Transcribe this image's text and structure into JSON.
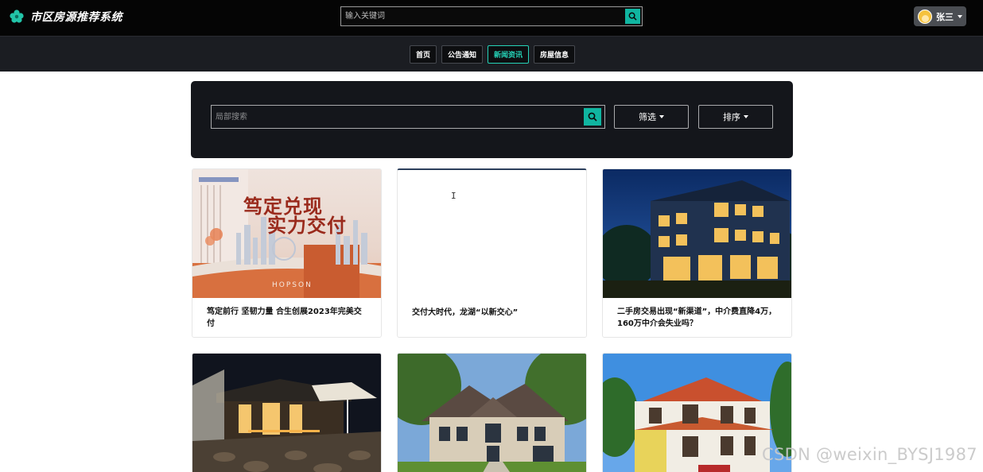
{
  "app": {
    "title": "市区房源推荐系统"
  },
  "header": {
    "search_placeholder": "输入关键词",
    "user_name": "张三"
  },
  "nav": {
    "items": [
      {
        "label": "首页",
        "active": false
      },
      {
        "label": "公告通知",
        "active": false
      },
      {
        "label": "新闻资讯",
        "active": true
      },
      {
        "label": "房屋信息",
        "active": false
      }
    ]
  },
  "filter_panel": {
    "search_placeholder": "局部搜索",
    "filter_label": "筛选",
    "sort_label": "排序"
  },
  "news_cards": [
    {
      "title": "笃定前行 坚韧力量 合生创展2023年完美交付",
      "image_text": [
        "笃定兑现",
        "实力交付"
      ],
      "image_brand": "HOPSON"
    },
    {
      "title": "交付大时代，龙湖“以新交心”"
    },
    {
      "title": "二手房交易出现“新渠道”，中介费直降4万，160万中介会失业吗？"
    },
    {
      "title": ""
    },
    {
      "title": ""
    },
    {
      "title": ""
    }
  ],
  "watermark": "CSDN @weixin_BYSJ1987",
  "colors": {
    "accent": "#10b5a0",
    "active_nav": "#25d3b8",
    "topbar": "#050505",
    "navbar": "#1b1d22",
    "panel": "#14161b"
  },
  "icons": {
    "brand": "leaf-logo-icon",
    "search": "search-icon",
    "caret": "caret-down-icon"
  }
}
